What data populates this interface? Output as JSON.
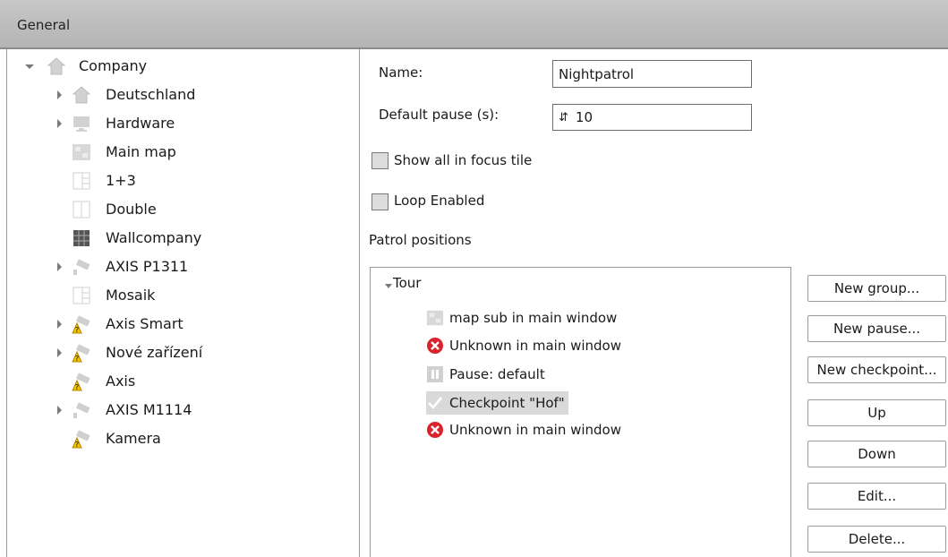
{
  "header": {
    "title": "General"
  },
  "tree": {
    "root": "Company",
    "items": [
      "Deutschland",
      "Hardware",
      "Main map",
      "1+3",
      "Double",
      "Wallcompany",
      "AXIS P1311",
      "Mosaik",
      "Axis Smart",
      "Nové zařízení",
      "Axis",
      "AXIS M1114",
      "Kamera"
    ]
  },
  "form": {
    "name_label": "Name:",
    "name_value": "Nightpatrol",
    "pause_label": "Default pause (s):",
    "pause_value": "10",
    "focus_label": "Show all in focus tile",
    "loop_label": "Loop Enabled",
    "positions_label": "Patrol positions"
  },
  "patrol": {
    "group": "Tour",
    "items": [
      "map sub in main window",
      "Unknown in main window",
      "Pause: default",
      "Checkpoint \"Hof\"",
      "Unknown in main window"
    ]
  },
  "buttons": {
    "new_group": "New group...",
    "new_pause": "New pause...",
    "new_checkpoint": "New checkpoint...",
    "up": "Up",
    "down": "Down",
    "edit": "Edit...",
    "delete": "Delete..."
  },
  "colors": {
    "header": "#bdbdbd",
    "warning": "#f2c200",
    "error": "#d9232e",
    "selection": "#d9d9d9"
  }
}
